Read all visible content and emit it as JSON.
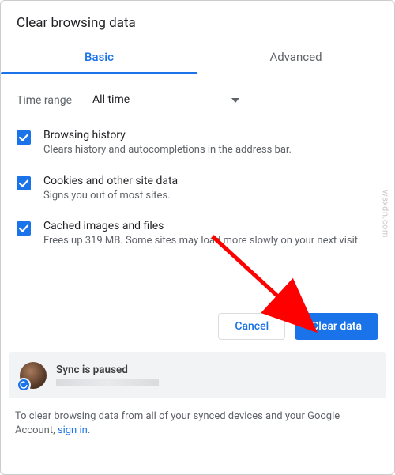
{
  "dialog": {
    "title": "Clear browsing data"
  },
  "tabs": {
    "basic": "Basic",
    "advanced": "Advanced"
  },
  "time_range": {
    "label": "Time range",
    "selected": "All time"
  },
  "options": [
    {
      "title": "Browsing history",
      "desc": "Clears history and autocompletions in the address bar."
    },
    {
      "title": "Cookies and other site data",
      "desc": "Signs you out of most sites."
    },
    {
      "title": "Cached images and files",
      "desc": "Frees up 319 MB. Some sites may load more slowly on your next visit."
    }
  ],
  "actions": {
    "cancel": "Cancel",
    "clear": "Clear data"
  },
  "sync": {
    "status": "Sync is paused"
  },
  "footer": {
    "text": "To clear browsing data from all of your synced devices and your Google Account, ",
    "link": "sign in",
    "suffix": "."
  },
  "watermark": "wsxdn.com"
}
